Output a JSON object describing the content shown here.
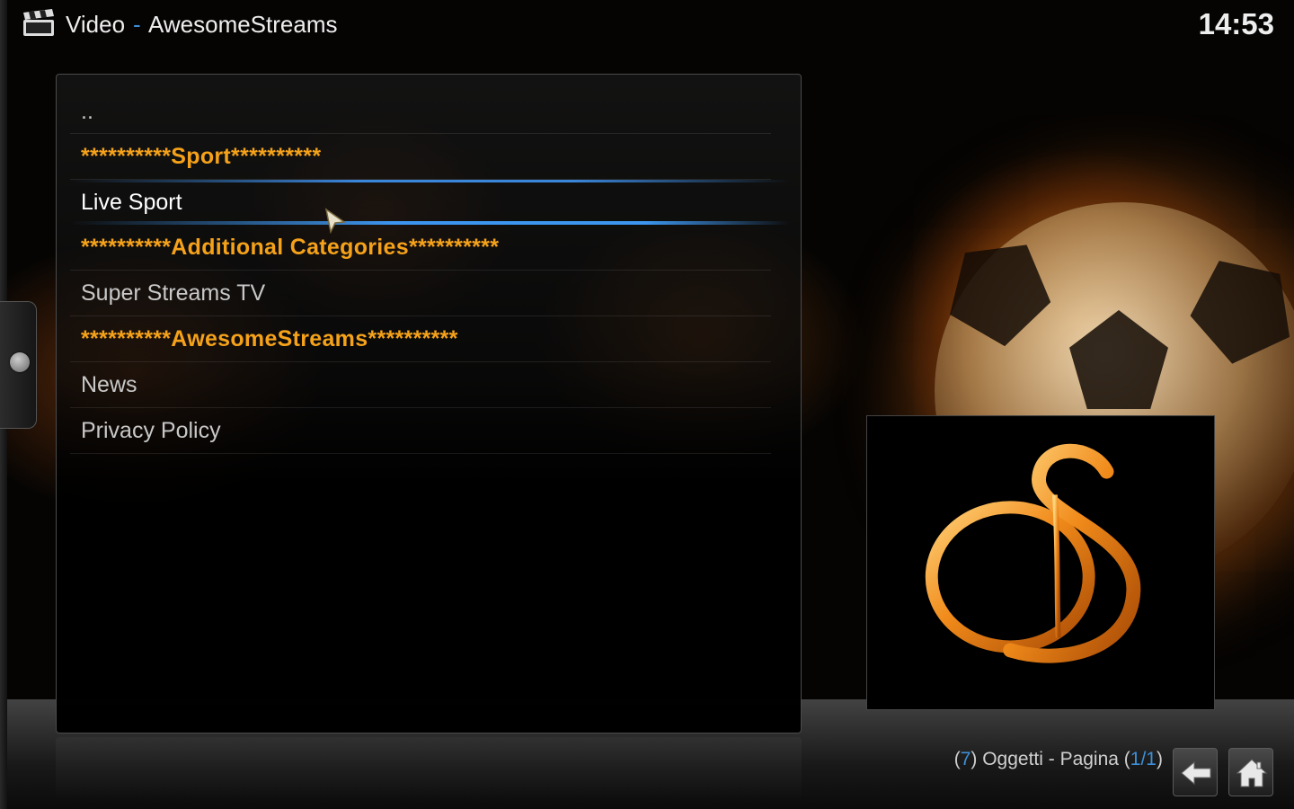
{
  "header": {
    "section_title": "Video",
    "separator": "-",
    "addon_name": "AwesomeStreams",
    "clock": "14:53"
  },
  "list": {
    "items": [
      {
        "label": "..",
        "type": "parent"
      },
      {
        "label": "**********Sport**********",
        "type": "header"
      },
      {
        "label": "Live Sport",
        "type": "item",
        "focused": true
      },
      {
        "label": "**********Additional Categories**********",
        "type": "header"
      },
      {
        "label": "Super Streams TV",
        "type": "item"
      },
      {
        "label": "**********AwesomeStreams**********",
        "type": "header"
      },
      {
        "label": "News",
        "type": "item"
      },
      {
        "label": "Privacy Policy",
        "type": "item"
      }
    ]
  },
  "footer": {
    "open_paren": "(",
    "count": "7",
    "items_text": ") Oggetti - Pagina (",
    "page": "1/1",
    "close_paren": ")"
  },
  "icons": {
    "header": "clapperboard-icon",
    "back": "back-arrow-icon",
    "home": "home-icon",
    "side": "side-menu-knob-icon"
  },
  "colors": {
    "accent": "#3d8fd8",
    "category_header": "#f5a21a",
    "focus_bar": "#3c96f0"
  }
}
